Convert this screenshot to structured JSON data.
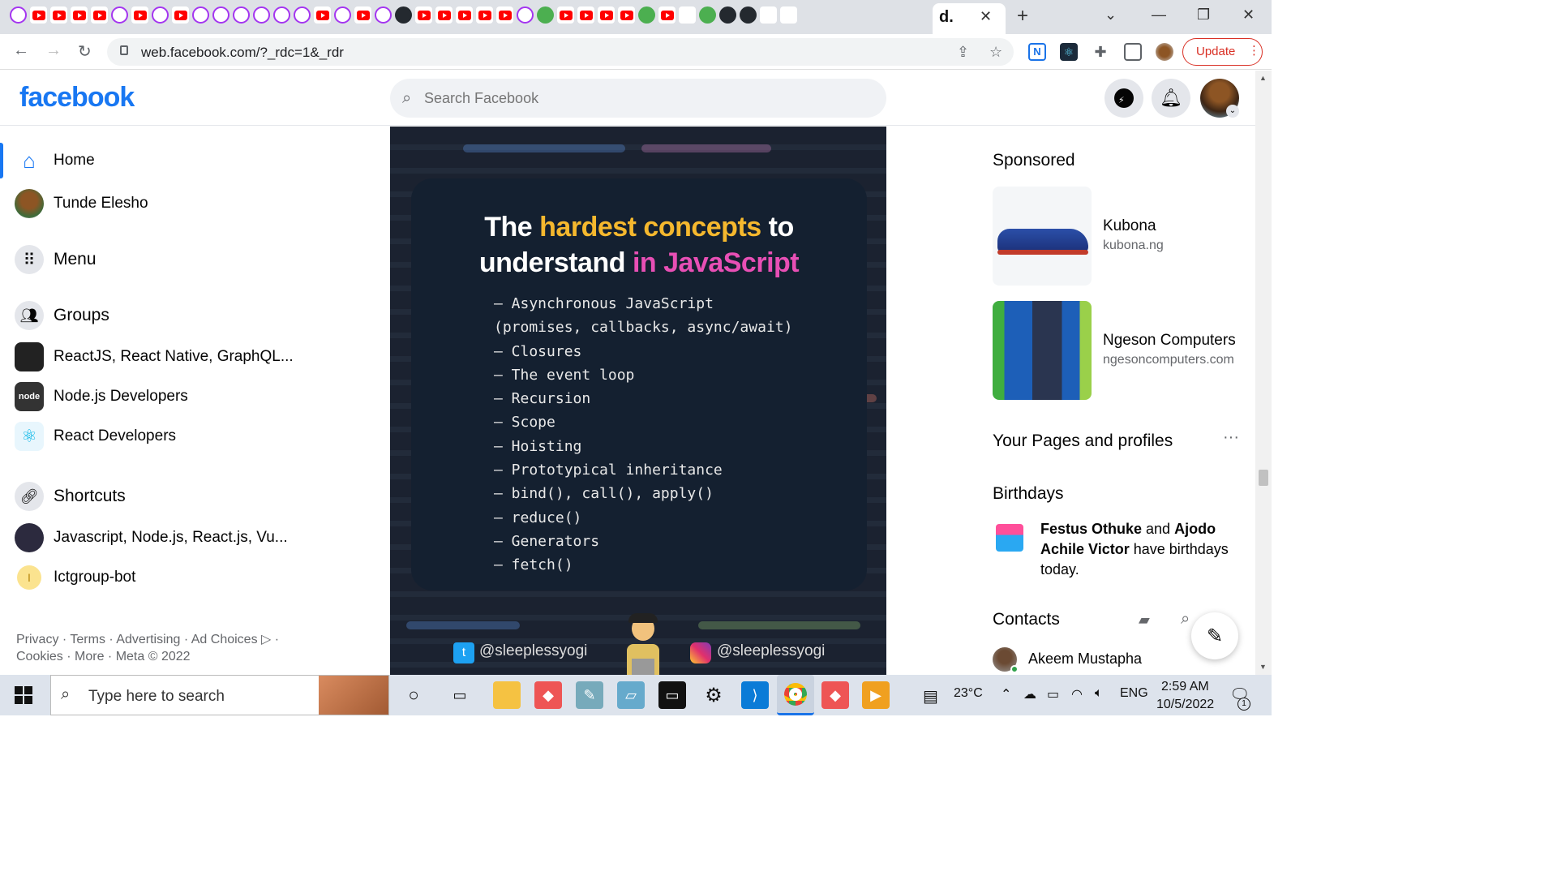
{
  "browser": {
    "url": "web.facebook.com/?_rdc=1&_rdr",
    "update_label": "Update",
    "tab_letter": "d."
  },
  "fb": {
    "logo": "facebook",
    "search_placeholder": "Search Facebook"
  },
  "left_nav": {
    "items": [
      {
        "label": "Home"
      },
      {
        "label": "Tunde Elesho"
      },
      {
        "label": "Menu"
      },
      {
        "label": "Groups"
      },
      {
        "label": "ReactJS, React Native, GraphQL..."
      },
      {
        "label": "Node.js Developers"
      },
      {
        "label": "React Developers"
      },
      {
        "label": "Shortcuts"
      },
      {
        "label": "Javascript, Node.js, React.js, Vu..."
      },
      {
        "label": "Ictgroup-bot"
      }
    ],
    "shortcut_initial": "I",
    "footer_line1": "Privacy · Terms · Advertising · Ad Choices ▷ ·",
    "footer_line2": "Cookies · More · Meta © 2022"
  },
  "post": {
    "title_white1": "The ",
    "title_yellow": "hardest concepts",
    "title_white2": " to",
    "title_white3": "understand ",
    "title_pink": "in JavaScript",
    "list": [
      "– Asynchronous JavaScript",
      "(promises, callbacks, async/await)",
      "– Closures",
      "– The event loop",
      "– Recursion",
      "– Scope",
      "– Hoisting",
      "– Prototypical inheritance",
      "– bind(), call(), apply()",
      "– reduce()",
      "– Generators",
      "– fetch()"
    ],
    "twitter_handle": "@sleeplessyogi",
    "instagram_handle": "@sleeplessyogi"
  },
  "right": {
    "sponsored": "Sponsored",
    "ads": [
      {
        "name": "Kubona",
        "url": "kubona.ng"
      },
      {
        "name": "Ngeson Computers",
        "url": "ngesoncomputers.com"
      }
    ],
    "pages_heading": "Your Pages and profiles",
    "birthdays_heading": "Birthdays",
    "birthday_name1": "Festus Othuke",
    "birthday_and": " and ",
    "birthday_name2": "Ajodo Achile Victor",
    "birthday_rest": " have birthdays today.",
    "contacts_heading": "Contacts",
    "contact1": "Akeem Mustapha"
  },
  "taskbar": {
    "search_placeholder": "Type here to search",
    "temperature": "23°C",
    "language": "ENG",
    "time": "2:59 AM",
    "date": "10/5/2022",
    "notification_count": "1"
  },
  "colors": {
    "fb_blue": "#1877f2",
    "title_yellow": "#f5b82e",
    "title_pink": "#e84fb5"
  }
}
